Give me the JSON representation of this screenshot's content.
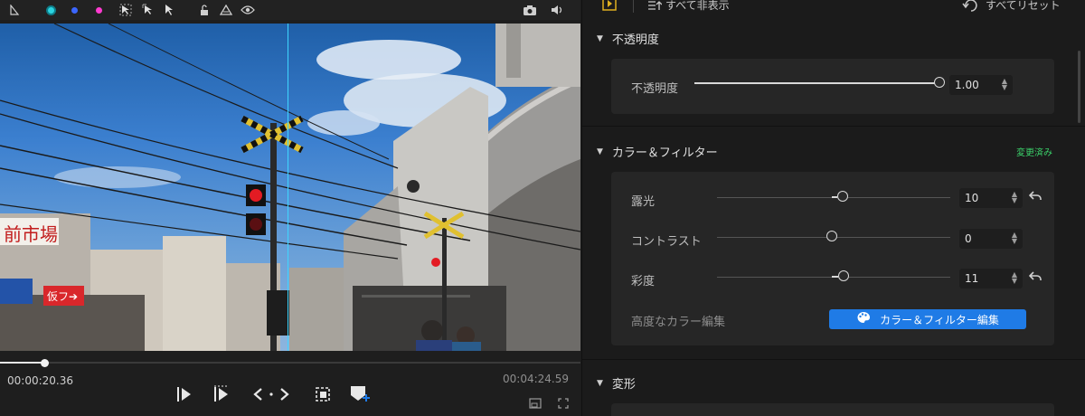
{
  "viewer": {
    "time_current": "00:00:20.36",
    "time_total": "00:04:24.59",
    "guide_color": "#3fd6ff",
    "toolbar_icons": [
      "trim-icon",
      "color-dot-cyan",
      "color-dot-blue",
      "color-dot-pink",
      "select-region-icon",
      "select-arrow-icon",
      "pointer-icon",
      "lock-icon",
      "mask-icon",
      "eye-icon",
      "camera-icon",
      "speaker-icon"
    ],
    "playback_progress": 0.08
  },
  "panel": {
    "hide_all_label": "すべて非表示",
    "reset_all_label": "すべてリセット",
    "opacity_section": {
      "title": "不透明度",
      "label": "不透明度",
      "value": "1.00",
      "level": 1.0
    },
    "color_section": {
      "title": "カラー＆フィルター",
      "badge": "変更済み",
      "rows": [
        {
          "label": "露光",
          "value": "10",
          "level": 0.55
        },
        {
          "label": "コントラスト",
          "value": "0",
          "level": 0.5
        },
        {
          "label": "彩度",
          "value": "11",
          "level": 0.55
        }
      ],
      "advanced_label": "高度なカラー編集",
      "advanced_button": "カラー＆フィルター編集"
    },
    "transform_section": {
      "title": "変形"
    },
    "accent_color": "#1f7be6",
    "badge_color": "#3bd16a"
  }
}
